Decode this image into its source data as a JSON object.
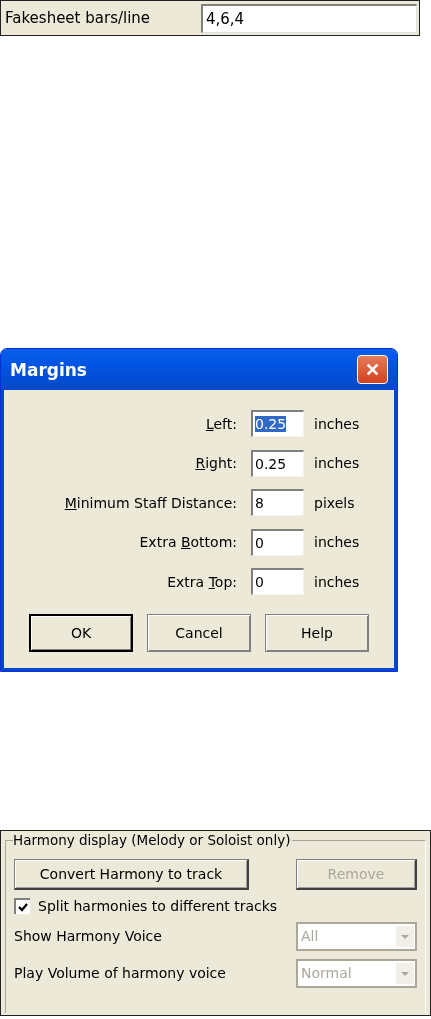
{
  "fakesheet": {
    "label": "Fakesheet bars/line",
    "value": "4,6,4"
  },
  "margins_dialog": {
    "title": "Margins",
    "close": "✕",
    "rows": [
      {
        "label": {
          "key": "L",
          "after": "eft:"
        },
        "value": "0.25",
        "text_selected": true,
        "unit": "inches"
      },
      {
        "label": {
          "key": "R",
          "after": "ight:"
        },
        "value": "0.25",
        "text_selected": false,
        "unit": "inches"
      },
      {
        "label": {
          "key": "M",
          "after": "inimum Staff Distance:"
        },
        "value": "8",
        "text_selected": false,
        "unit": "pixels"
      },
      {
        "label": {
          "before": "Extra ",
          "key": "B",
          "after": "ottom:"
        },
        "value": "0",
        "text_selected": false,
        "unit": "inches"
      },
      {
        "label": {
          "before": "Extra ",
          "key": "T",
          "after": "op:"
        },
        "value": "0",
        "text_selected": false,
        "unit": "inches"
      }
    ],
    "buttons": [
      {
        "label": "OK",
        "default": true
      },
      {
        "label": "Cancel",
        "default": false
      },
      {
        "label": "Help",
        "default": false
      }
    ]
  },
  "harmony": {
    "legend": "Harmony display (Melody or Soloist only)",
    "buttons": [
      {
        "label": "Convert Harmony to track",
        "disabled": false
      },
      {
        "label": "Remove",
        "disabled": true
      }
    ],
    "checkbox": {
      "label": "Split harmonies to different tracks",
      "checked": true
    },
    "combos": [
      {
        "label": "Show Harmony Voice",
        "value": "All",
        "disabled": true
      },
      {
        "label": "Play Volume of harmony voice",
        "value": "Normal",
        "disabled": true
      }
    ]
  }
}
